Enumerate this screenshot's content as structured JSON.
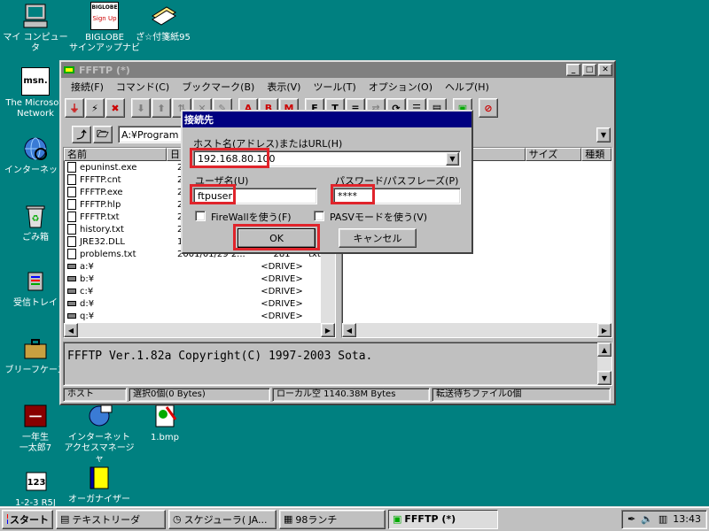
{
  "desktop": {
    "icons": [
      {
        "label": "マイ コンピュータ"
      },
      {
        "label": "BIGLOBE\nサインアップナビ"
      },
      {
        "label": "ざ☆付箋紙95"
      },
      {
        "label": "The Microsoft\nNetwork"
      },
      {
        "label": "インターネット"
      },
      {
        "label": "ごみ箱"
      },
      {
        "label": "受信トレイ"
      },
      {
        "label": "ブリーフケース"
      },
      {
        "label": "一年生\n一太郎7"
      },
      {
        "label": "インターネット\nアクセスマネージャ"
      },
      {
        "label": "1.bmp"
      },
      {
        "label": "1-2-3 R5J"
      },
      {
        "label": "オーガナイザー"
      }
    ],
    "biglobe_logo": "BIGLOBE",
    "signup_logo": "Sign Up",
    "msn_logo": "msn."
  },
  "window": {
    "title": "FFFTP (*)",
    "menu": [
      "接続(F)",
      "コマンド(C)",
      "ブックマーク(B)",
      "表示(V)",
      "ツール(T)",
      "オプション(O)",
      "ヘルプ(H)"
    ],
    "local_path": "A:¥Program",
    "local_header": {
      "name": "名前",
      "date": "日"
    },
    "remote_header": {
      "size": "サイズ",
      "kind": "種類"
    },
    "files": [
      {
        "name": "epuninst.exe",
        "date": "2"
      },
      {
        "name": "FFFTP.cnt",
        "date": "2"
      },
      {
        "name": "FFFTP.exe",
        "date": "2"
      },
      {
        "name": "FFFTP.hlp",
        "date": "2"
      },
      {
        "name": "FFFTP.txt",
        "date": "2"
      },
      {
        "name": "history.txt",
        "date": "2"
      },
      {
        "name": "JRE32.DLL",
        "date": "1"
      },
      {
        "name": "problems.txt",
        "date": "2001/01/29 2...",
        "size": "281",
        "ext": "txt"
      },
      {
        "name": "a:¥",
        "size": "<DRIVE>"
      },
      {
        "name": "b:¥",
        "size": "<DRIVE>"
      },
      {
        "name": "c:¥",
        "size": "<DRIVE>"
      },
      {
        "name": "d:¥",
        "size": "<DRIVE>"
      },
      {
        "name": "q:¥",
        "size": "<DRIVE>"
      }
    ],
    "log": "FFFTP Ver.1.82a Copyright(C) 1997-2003 Sota.",
    "status": {
      "host": "ホスト",
      "selection": "選択0個(0 Bytes)",
      "local_free": "ローカル空 1140.38M Bytes",
      "queue": "転送待ちファイル0個"
    }
  },
  "dialog": {
    "title": "接続先",
    "host_label": "ホスト名(アドレス)またはURL(H)",
    "host_value": "192.168.80.100",
    "user_label": "ユーザ名(U)",
    "user_value": "ftpuser",
    "pass_label": "パスワード/パスフレーズ(P)",
    "pass_value": "****",
    "firewall_label": "FireWallを使う(F)",
    "pasv_label": "PASVモードを使う(V)",
    "ok_label": "OK",
    "cancel_label": "キャンセル"
  },
  "taskbar": {
    "start": "スタート",
    "items": [
      "テキストリーダ",
      "スケジューラ( JA...",
      "98ランチ",
      "FFFTP (*)"
    ],
    "clock": "13:43"
  },
  "colors": {
    "desktop": "#008080",
    "titlebar_active": "#000080",
    "highlight_red": "#e0242b"
  }
}
